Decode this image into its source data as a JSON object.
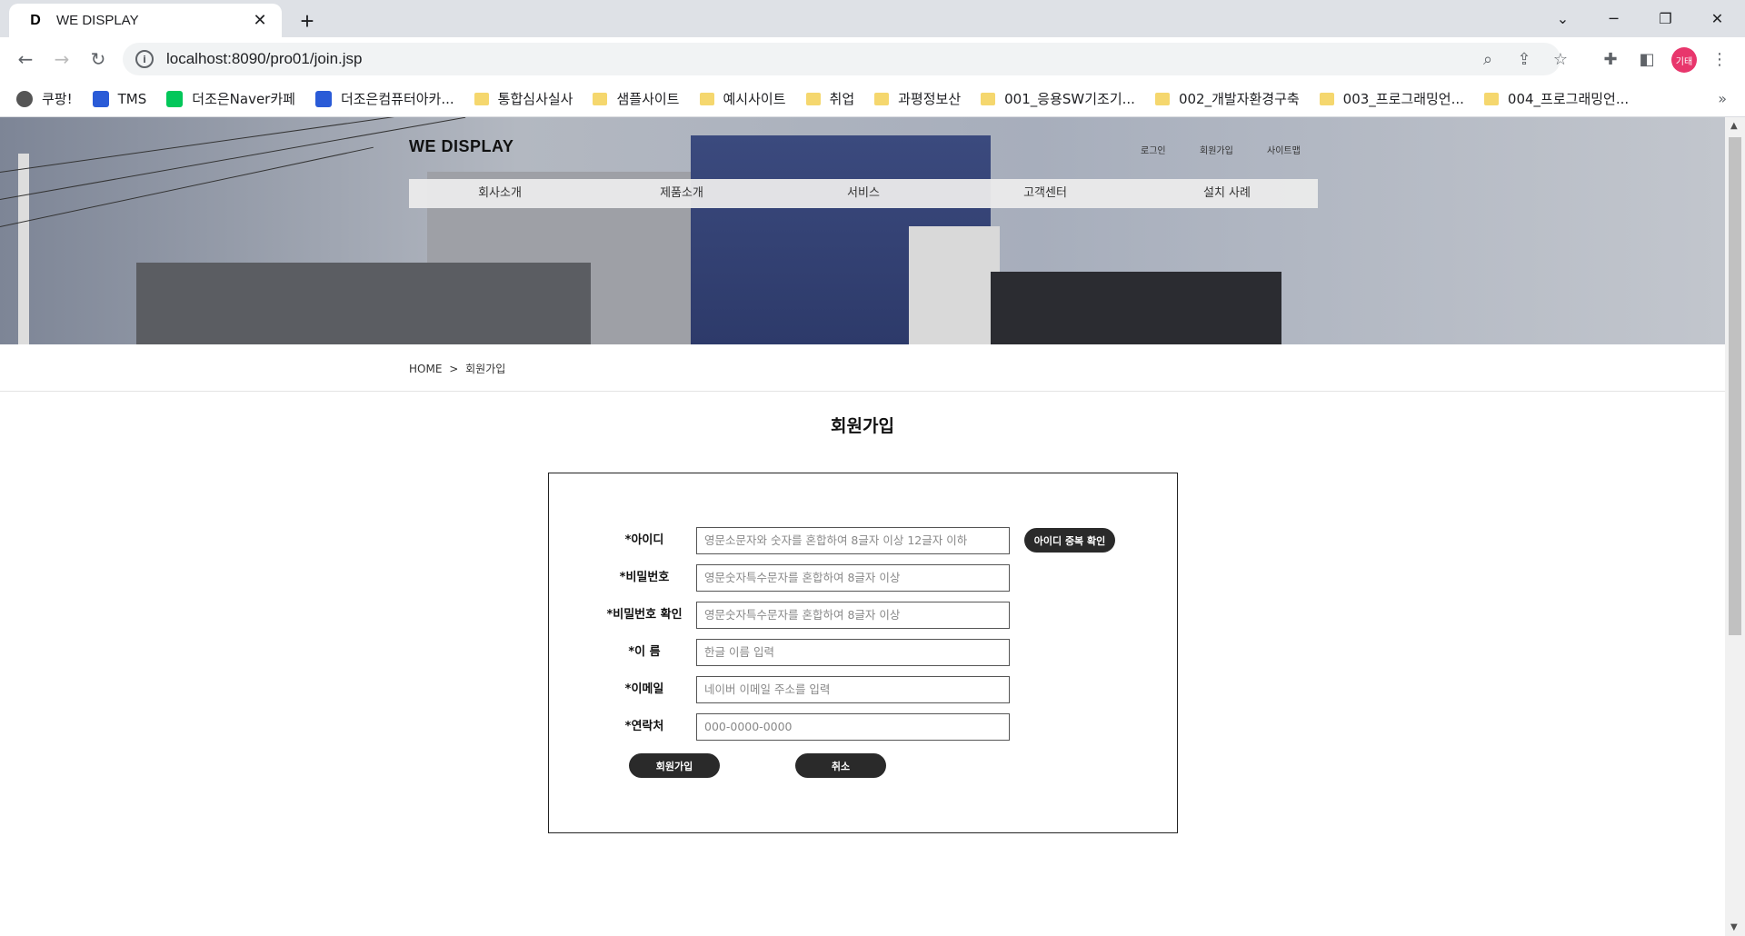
{
  "browser": {
    "tab_title": "WE DISPLAY",
    "tab_favicon": "D",
    "url": "localhost:8090/pro01/join.jsp",
    "profile_label": "기태",
    "bookmarks": [
      {
        "label": "쿠팡!",
        "icon": "globe-icon"
      },
      {
        "label": "TMS",
        "icon": "tms-icon"
      },
      {
        "label": "더조은Naver카페",
        "icon": "naver-cafe-icon"
      },
      {
        "label": "더조은컴퓨터아카...",
        "icon": "academy-icon"
      },
      {
        "label": "통합심사실사",
        "icon": "folder-icon"
      },
      {
        "label": "샘플사이트",
        "icon": "folder-icon"
      },
      {
        "label": "예시사이트",
        "icon": "folder-icon"
      },
      {
        "label": "취업",
        "icon": "folder-icon"
      },
      {
        "label": "과평정보산",
        "icon": "folder-icon"
      },
      {
        "label": "001_응용SW기조기...",
        "icon": "folder-icon"
      },
      {
        "label": "002_개발자환경구축",
        "icon": "folder-icon"
      },
      {
        "label": "003_프로그래밍언...",
        "icon": "folder-icon"
      },
      {
        "label": "004_프로그래밍언...",
        "icon": "folder-icon"
      }
    ]
  },
  "site": {
    "logo": "WE DISPLAY",
    "util_links": [
      "로그인",
      "회원가입",
      "사이트맵"
    ],
    "gnb": [
      "회사소개",
      "제품소개",
      "서비스",
      "고객센터",
      "설치 사례"
    ],
    "breadcrumb_home": "HOME",
    "breadcrumb_sep": ">",
    "breadcrumb_current": "회원가입",
    "page_title": "회원가입"
  },
  "form": {
    "fields": [
      {
        "label": "*아이디",
        "placeholder": "영문소문자와 숫자를 혼합하여 8글자 이상 12글자 이하"
      },
      {
        "label": "*비밀번호",
        "placeholder": "영문숫자특수문자를 혼합하여 8글자 이상"
      },
      {
        "label": "*비밀번호 확인",
        "placeholder": "영문숫자특수문자를 혼합하여 8글자 이상"
      },
      {
        "label": "*이 름",
        "placeholder": "한글 이름 입력"
      },
      {
        "label": "*이메일",
        "placeholder": "네이버 이메일 주소를 입력"
      },
      {
        "label": "*연락처",
        "placeholder": "000-0000-0000"
      }
    ],
    "id_check_label": "아이디 중복 확인",
    "submit_label": "회원가입",
    "cancel_label": "취소"
  }
}
